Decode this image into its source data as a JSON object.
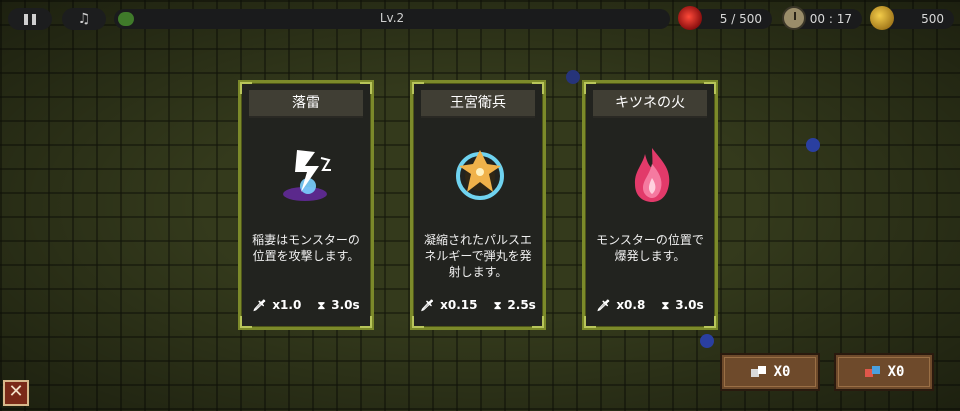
{
  "hud": {
    "level_label": "Lv.2",
    "level_progress": 0.03,
    "monsters": "5 / 500",
    "timer": "00 : 17",
    "gold": "500"
  },
  "cards": [
    {
      "title": "落雷",
      "description": "稲妻はモンスターの位置を攻撃します。",
      "damage": "x1.0",
      "cooldown": "3.0s"
    },
    {
      "title": "王宮衛兵",
      "description": "凝縮されたパルスエネルギーで弾丸を発射します。",
      "damage": "x0.15",
      "cooldown": "2.5s"
    },
    {
      "title": "キツネの火",
      "description": "モンスターの位置で爆発します。",
      "damage": "x0.8",
      "cooldown": "3.0s"
    }
  ],
  "items": [
    {
      "count": "X0"
    },
    {
      "count": "X0"
    }
  ]
}
